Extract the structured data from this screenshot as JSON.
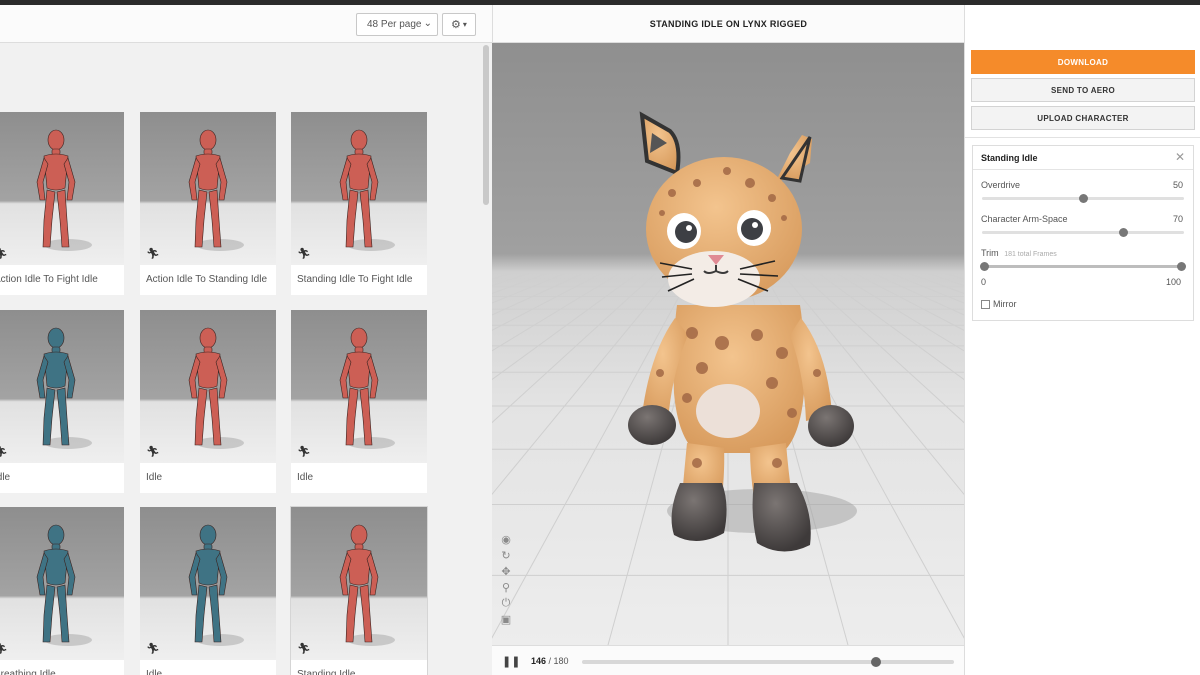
{
  "toolbar": {
    "per_page": "48 Per page"
  },
  "grid": {
    "cards": [
      {
        "name": "Action Idle To Fight Idle",
        "color": "#cc5f55"
      },
      {
        "name": "Action Idle To Standing Idle",
        "color": "#cc5f55"
      },
      {
        "name": "Standing Idle To Fight Idle",
        "color": "#cc5f55"
      },
      {
        "name": "Idle",
        "color": "#3f7384"
      },
      {
        "name": "Idle",
        "color": "#cc5f55"
      },
      {
        "name": "Idle",
        "color": "#cc5f55"
      },
      {
        "name": "Breathing Idle",
        "color": "#3f7384"
      },
      {
        "name": "Idle",
        "color": "#3f7384"
      },
      {
        "name": "Standing Idle",
        "color": "#cc5f55"
      }
    ]
  },
  "viewer": {
    "title": "STANDING IDLE ON LYNX RIGGED",
    "current_frame": "146",
    "total_frames": "/ 180",
    "progress": 0.79
  },
  "actions": {
    "download": "DOWNLOAD",
    "send": "SEND TO AERO",
    "upload": "UPLOAD CHARACTER",
    "primary_color": "#f58b2a"
  },
  "settings": {
    "title": "Standing Idle",
    "overdrive_label": "Overdrive",
    "overdrive_value": "50",
    "overdrive_level": 0.5,
    "arm_label": "Character Arm-Space",
    "arm_value": "70",
    "arm_level": 0.7,
    "trim_label": "Trim",
    "trim_sub": "181 total Frames",
    "trim_min": "0",
    "trim_max": "100",
    "mirror_label": "Mirror"
  }
}
